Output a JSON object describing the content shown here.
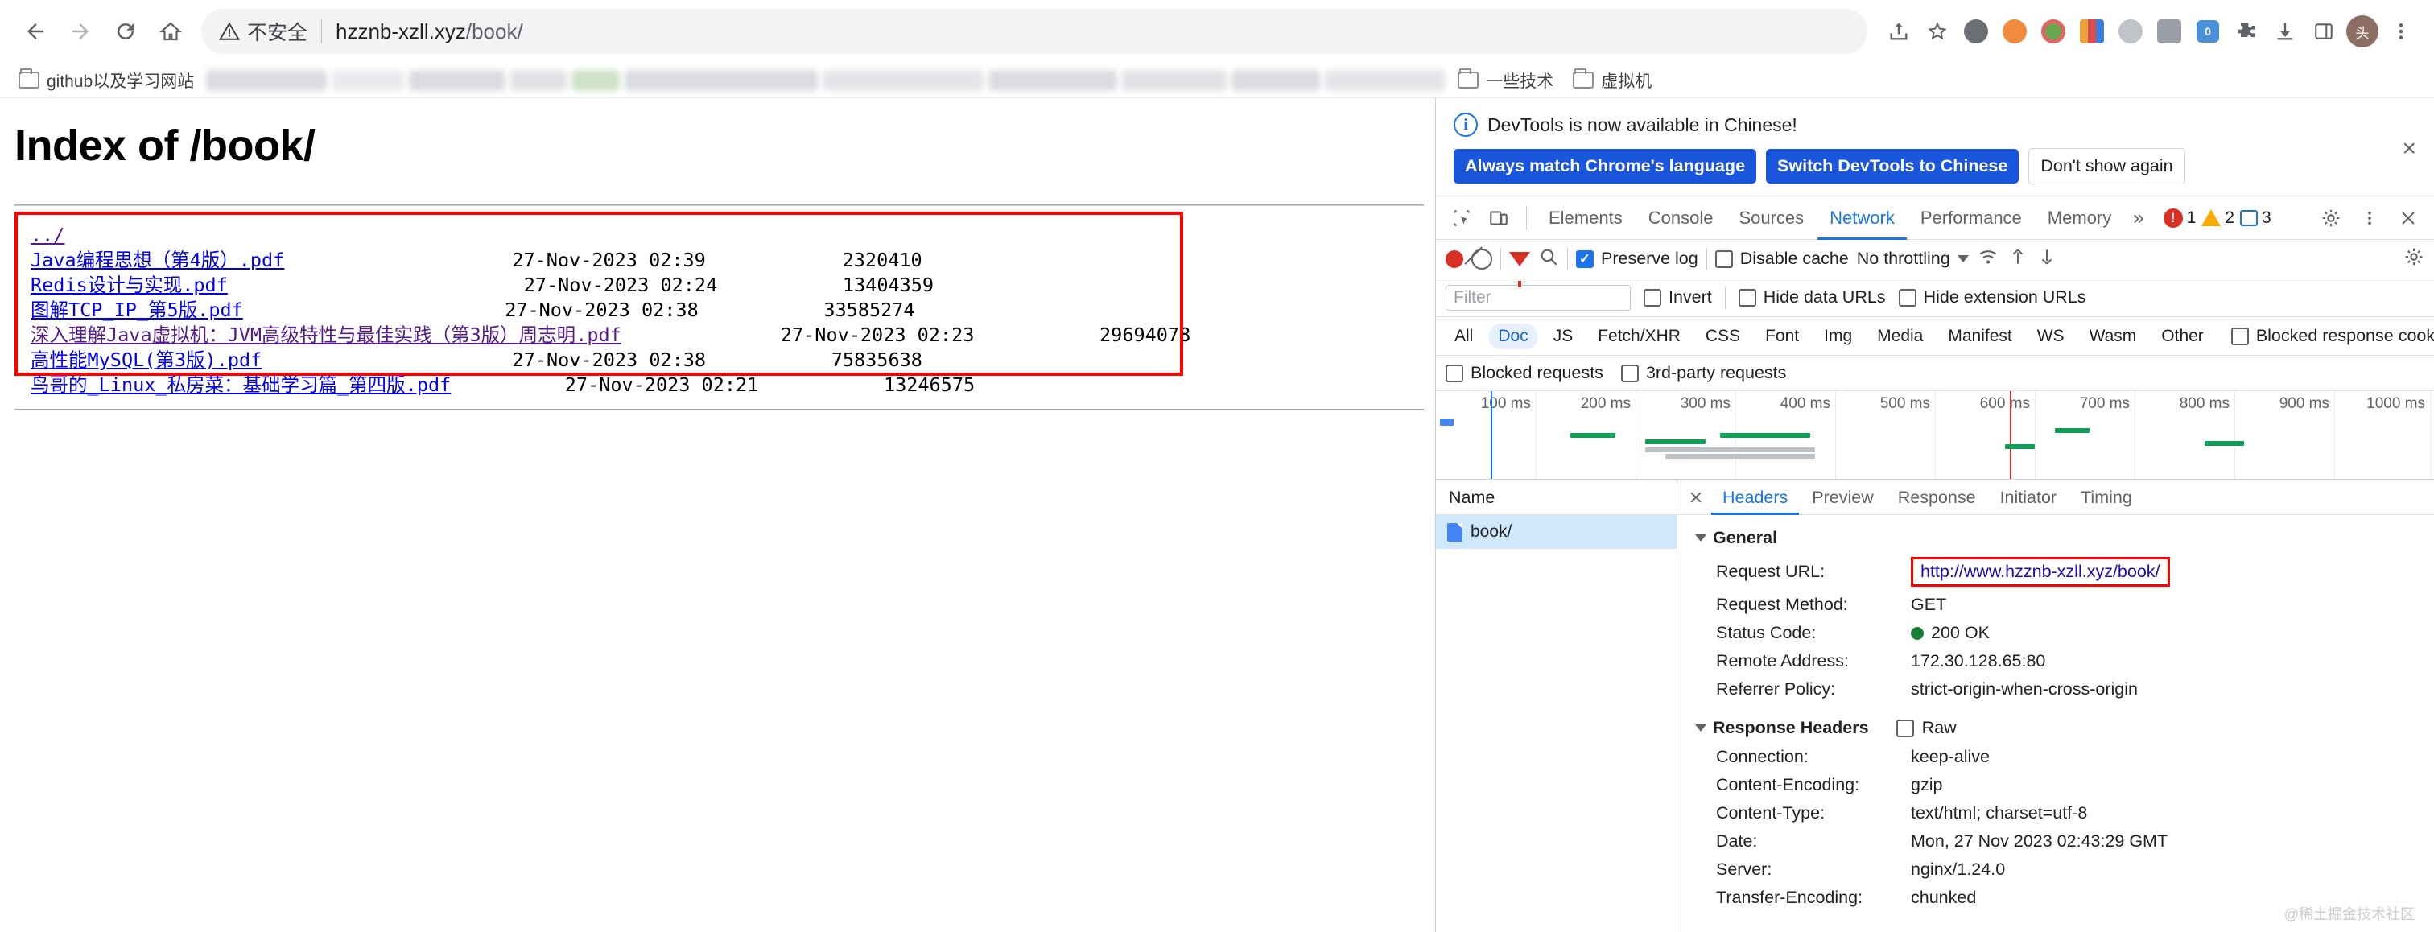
{
  "browser": {
    "nav": {
      "back": "back-arrow",
      "forward": "forward-arrow",
      "reload": "reload",
      "home": "home"
    },
    "omnibox": {
      "security_label": "不安全",
      "url_host": "hzznb-xzll.xyz",
      "url_path": "/book/"
    },
    "bookmarks": [
      {
        "label": "github以及学习网站",
        "blurred": false
      },
      {
        "label": "",
        "blurred": true
      },
      {
        "label": "",
        "blurred": true
      },
      {
        "label": "一些技术",
        "blurred": false
      },
      {
        "label": "虚拟机",
        "blurred": false
      }
    ]
  },
  "page": {
    "title": "Index of /book/",
    "columns": [
      "name",
      "date",
      "size"
    ],
    "entries": [
      {
        "name": "../",
        "date": "",
        "size": "",
        "visited": true
      },
      {
        "name": "Java编程思想（第4版）.pdf",
        "date": "27-Nov-2023 02:39",
        "size": "2320410",
        "visited": false
      },
      {
        "name": "Redis设计与实现.pdf",
        "date": "27-Nov-2023 02:24",
        "size": "13404359",
        "visited": false
      },
      {
        "name": "图解TCP_IP_第5版.pdf",
        "date": "27-Nov-2023 02:38",
        "size": "33585274",
        "visited": false
      },
      {
        "name": "深入理解Java虚拟机：JVM高级特性与最佳实践（第3版）周志明.pdf",
        "date": "27-Nov-2023 02:23",
        "size": "29694078",
        "visited": true
      },
      {
        "name": "高性能MySQL(第3版).pdf",
        "date": "27-Nov-2023 02:38",
        "size": "75835638",
        "visited": false
      },
      {
        "name": "鸟哥的_Linux_私房菜：基础学习篇_第四版.pdf",
        "date": "27-Nov-2023 02:21",
        "size": "13246575",
        "visited": false
      }
    ]
  },
  "devtools": {
    "banner": {
      "message": "DevTools is now available in Chinese!",
      "btn_always": "Always match Chrome's language",
      "btn_switch": "Switch DevTools to Chinese",
      "btn_dismiss": "Don't show again",
      "close": "×"
    },
    "tabs": [
      {
        "label": "Elements",
        "active": false
      },
      {
        "label": "Console",
        "active": false
      },
      {
        "label": "Sources",
        "active": false
      },
      {
        "label": "Network",
        "active": true
      },
      {
        "label": "Performance",
        "active": false
      },
      {
        "label": "Memory",
        "active": false
      }
    ],
    "overflow": "»",
    "counts": {
      "errors": "1",
      "warnings": "2",
      "messages": "3"
    },
    "toolbar": {
      "preserve_log": {
        "label": "Preserve log",
        "checked": true
      },
      "disable_cache": {
        "label": "Disable cache",
        "checked": false
      },
      "throttling": "No throttling"
    },
    "filters": {
      "placeholder": "Filter",
      "invert": {
        "label": "Invert",
        "checked": false
      },
      "hide_data_urls": {
        "label": "Hide data URLs",
        "checked": false
      },
      "hide_ext_urls": {
        "label": "Hide extension URLs",
        "checked": false
      }
    },
    "types": [
      {
        "label": "All",
        "active": false
      },
      {
        "label": "Doc",
        "active": true
      },
      {
        "label": "JS",
        "active": false
      },
      {
        "label": "Fetch/XHR",
        "active": false
      },
      {
        "label": "CSS",
        "active": false
      },
      {
        "label": "Font",
        "active": false
      },
      {
        "label": "Img",
        "active": false
      },
      {
        "label": "Media",
        "active": false
      },
      {
        "label": "Manifest",
        "active": false
      },
      {
        "label": "WS",
        "active": false
      },
      {
        "label": "Wasm",
        "active": false
      },
      {
        "label": "Other",
        "active": false
      }
    ],
    "blocked_cookies": {
      "label": "Blocked response cookies",
      "checked": false
    },
    "request_options": {
      "blocked_requests": {
        "label": "Blocked requests",
        "checked": false
      },
      "third_party": {
        "label": "3rd-party requests",
        "checked": false
      }
    },
    "timeline_ticks": [
      "100 ms",
      "200 ms",
      "300 ms",
      "400 ms",
      "500 ms",
      "600 ms",
      "700 ms",
      "800 ms",
      "900 ms",
      "1000 ms"
    ],
    "request_list": {
      "header": "Name",
      "rows": [
        {
          "name": "book/",
          "selected": true
        }
      ]
    },
    "detail_tabs": [
      {
        "label": "Headers",
        "active": true
      },
      {
        "label": "Preview",
        "active": false
      },
      {
        "label": "Response",
        "active": false
      },
      {
        "label": "Initiator",
        "active": false
      },
      {
        "label": "Timing",
        "active": false
      }
    ],
    "general": {
      "title": "General",
      "rows": [
        {
          "key": "Request URL:",
          "value": "http://www.hzznb-xzll.xyz/book/",
          "highlight": true
        },
        {
          "key": "Request Method:",
          "value": "GET",
          "highlight": false
        },
        {
          "key": "Status Code:",
          "value": "200 OK",
          "status": true
        },
        {
          "key": "Remote Address:",
          "value": "172.30.128.65:80",
          "highlight": false
        },
        {
          "key": "Referrer Policy:",
          "value": "strict-origin-when-cross-origin",
          "highlight": false
        }
      ]
    },
    "response_headers": {
      "title": "Response Headers",
      "raw_label": "Raw",
      "rows": [
        {
          "key": "Connection:",
          "value": "keep-alive"
        },
        {
          "key": "Content-Encoding:",
          "value": "gzip"
        },
        {
          "key": "Content-Type:",
          "value": "text/html; charset=utf-8"
        },
        {
          "key": "Date:",
          "value": "Mon, 27 Nov 2023 02:43:29 GMT"
        },
        {
          "key": "Server:",
          "value": "nginx/1.24.0"
        },
        {
          "key": "Transfer-Encoding:",
          "value": "chunked"
        }
      ]
    },
    "watermark": "@稀土掘金技术社区"
  }
}
